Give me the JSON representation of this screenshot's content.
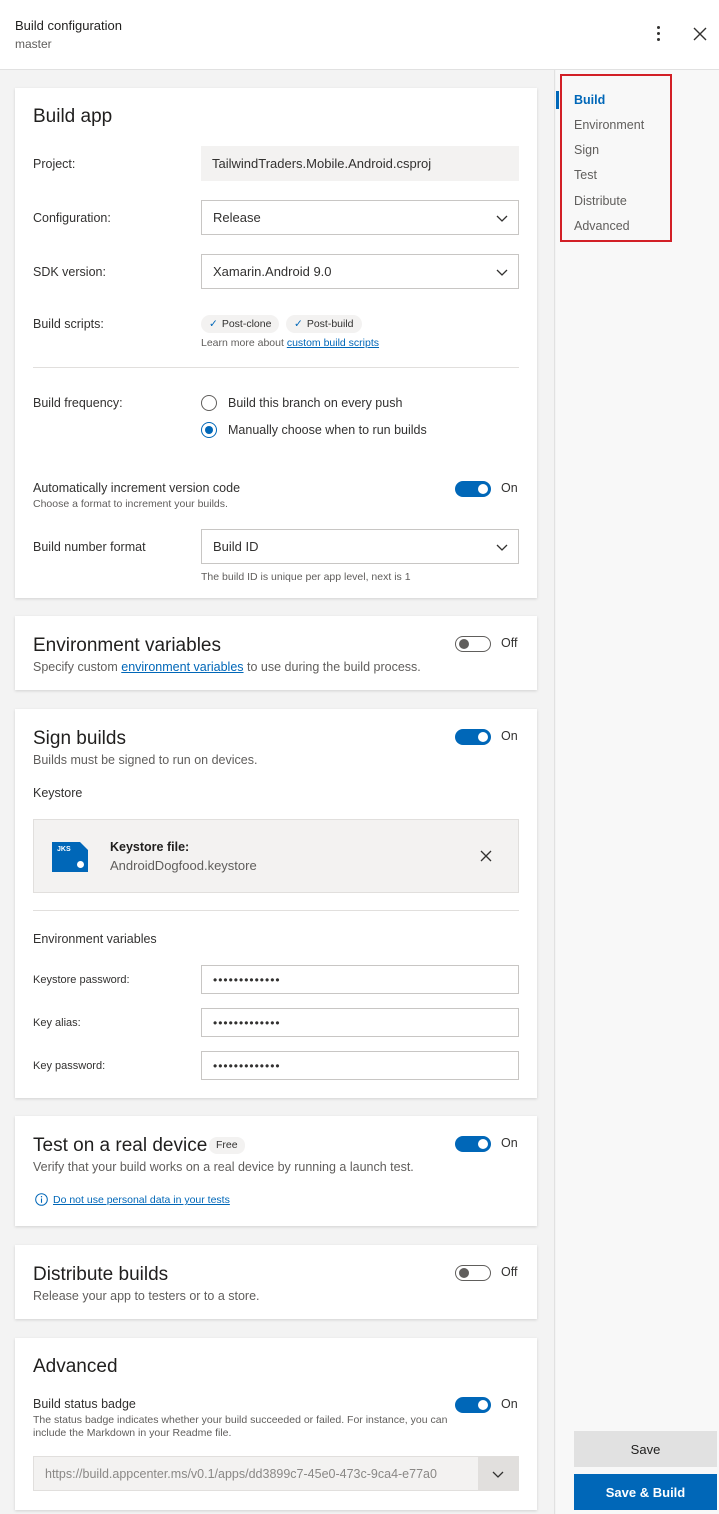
{
  "header": {
    "title": "Build configuration",
    "branch": "master"
  },
  "build_app": {
    "title": "Build app",
    "project_label": "Project:",
    "project_value": "TailwindTraders.Mobile.Android.csproj",
    "configuration_label": "Configuration:",
    "configuration_value": "Release",
    "sdk_label": "SDK version:",
    "sdk_value": "Xamarin.Android 9.0",
    "scripts_label": "Build scripts:",
    "scripts": [
      "Post-clone",
      "Post-build"
    ],
    "scripts_help_prefix": "Learn more about",
    "scripts_help_link": "custom build scripts",
    "frequency_label": "Build frequency:",
    "frequency_options": [
      "Build this branch on every push",
      "Manually choose when to run builds"
    ],
    "frequency_selected": 1,
    "auto_increment_label": "Automatically increment version code",
    "auto_increment_help": "Choose a format to increment your builds.",
    "auto_increment_state": "On",
    "build_number_label": "Build number format",
    "build_number_value": "Build ID",
    "build_number_help": "The build ID is unique per app level, next is 1"
  },
  "environment": {
    "title": "Environment variables",
    "desc_prefix": "Specify custom",
    "desc_link": "environment variables",
    "desc_suffix": "to use during the build process.",
    "state": "Off"
  },
  "sign": {
    "title": "Sign builds",
    "desc": "Builds must be signed to run on devices.",
    "state": "On",
    "keystore_label": "Keystore",
    "keystore_icon_text": "JKS",
    "keystore_file_label": "Keystore file:",
    "keystore_file_name": "AndroidDogfood.keystore",
    "env_label": "Environment variables",
    "keystore_password_label": "Keystore password:",
    "keystore_password_value": "•••••••••••••",
    "key_alias_label": "Key alias:",
    "key_alias_value": "•••••••••••••",
    "key_password_label": "Key password:",
    "key_password_value": "•••••••••••••"
  },
  "test": {
    "title": "Test on a real device",
    "badge": "Free",
    "desc": "Verify that your build works on a real device by running a launch test.",
    "state": "On",
    "notice_link": "Do not use personal data in your tests"
  },
  "distribute": {
    "title": "Distribute builds",
    "desc": "Release your app to testers or to a store.",
    "state": "Off"
  },
  "advanced": {
    "title": "Advanced",
    "badge_label": "Build status badge",
    "badge_help": "The status badge indicates whether your build succeeded or failed. For instance, you can include the Markdown in your Readme file.",
    "state": "On",
    "badge_url": "https://build.appcenter.ms/v0.1/apps/dd3899c7-45e0-473c-9ca4-e77a0"
  },
  "nav": {
    "items": [
      "Build",
      "Environment",
      "Sign",
      "Test",
      "Distribute",
      "Advanced"
    ],
    "active": 0
  },
  "actions": {
    "save": "Save",
    "save_build": "Save & Build"
  },
  "colors": {
    "accent": "#0067b8",
    "highlight_border": "#d21f26"
  }
}
